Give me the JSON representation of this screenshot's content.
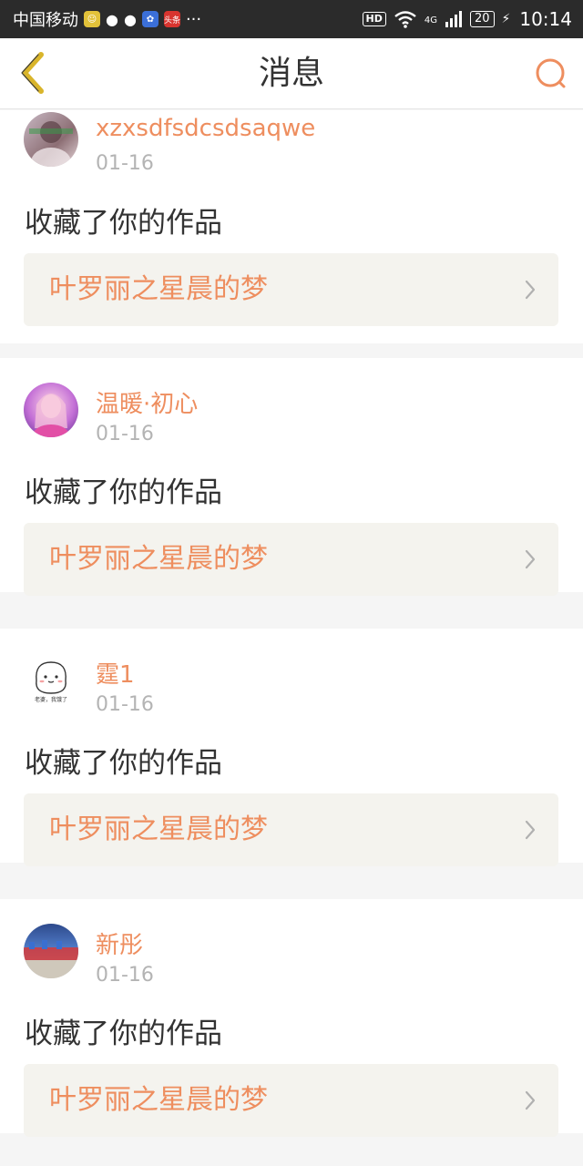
{
  "status_bar": {
    "carrier": "中国移动",
    "app_badge": "头条",
    "more": "···",
    "hd": "HD",
    "network": "4G",
    "battery": "20",
    "time": "10:14"
  },
  "header": {
    "title": "消息"
  },
  "notifications": [
    {
      "username": "xzxsdfsdcsdsaqwe",
      "date": "01-16",
      "action": "收藏了你的作品",
      "work_title": "叶罗丽之星晨的梦"
    },
    {
      "username": "温暖·初心",
      "date": "01-16",
      "action": "收藏了你的作品",
      "work_title": "叶罗丽之星晨的梦"
    },
    {
      "username": "霆1",
      "date": "01-16",
      "action": "收藏了你的作品",
      "work_title": "叶罗丽之星晨的梦",
      "avatar_caption": "老婆，我饿了"
    },
    {
      "username": "新彤",
      "date": "01-16",
      "action": "收藏了你的作品",
      "work_title": "叶罗丽之星晨的梦"
    }
  ],
  "colors": {
    "accent": "#ee8e5f",
    "status_bar_bg": "#2b2b2b",
    "work_box_bg": "#f4f3ee",
    "back_icon": "#d9b52b"
  }
}
